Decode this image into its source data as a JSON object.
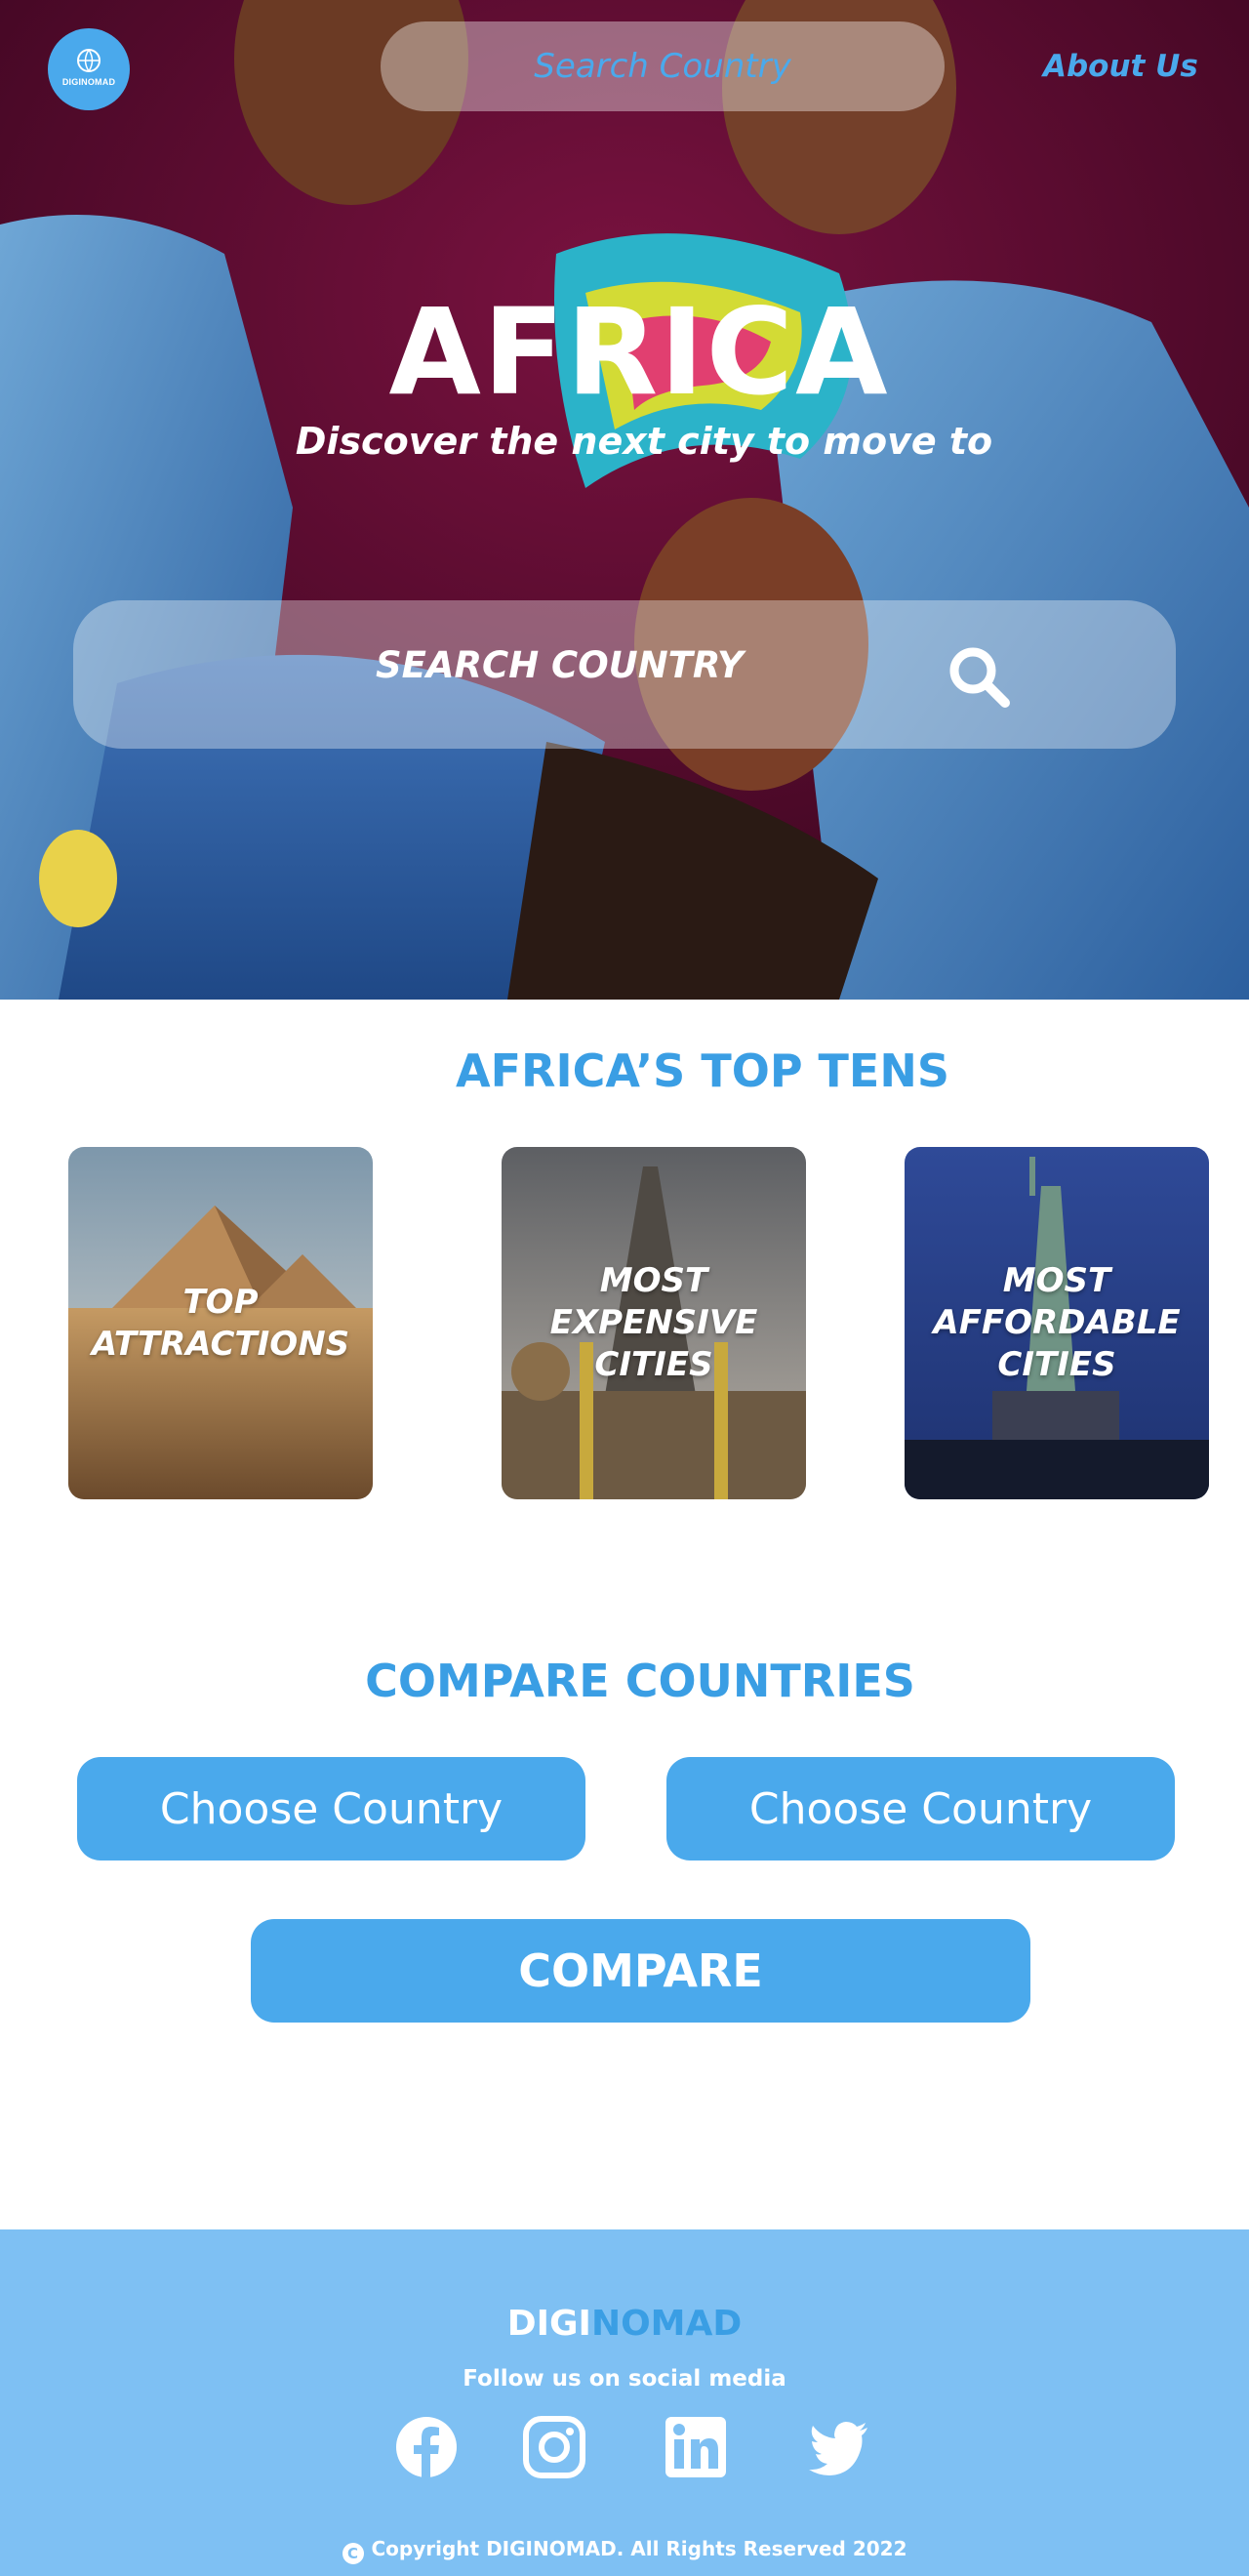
{
  "colors": {
    "accent": "#4aa9ec",
    "heading": "#3a9ee4",
    "footer_bg": "#7ec0f3",
    "hero_bg": "#5a0a2c"
  },
  "header": {
    "logo_text": "DIGINOMAD",
    "search_placeholder": "Search Country",
    "about_link": "About Us"
  },
  "hero": {
    "title": "AFRICA",
    "subtitle": "Discover the next city to move to",
    "search_label": "SEARCH COUNTRY",
    "search_icon": "search-icon"
  },
  "top_tens": {
    "title": "AFRICA’S TOP TENS",
    "cards": [
      {
        "label": "TOP\nATTRACTIONS",
        "image": "pyramids"
      },
      {
        "label": "MOST\nEXPENSIVE\nCITIES",
        "image": "eiffel-tower"
      },
      {
        "label": "MOST\nAFFORDABLE\nCITIES",
        "image": "statue-of-liberty"
      }
    ]
  },
  "compare": {
    "title": "COMPARE COUNTRIES",
    "choose_left": "Choose Country",
    "choose_right": "Choose Country",
    "compare_button": "COMPARE"
  },
  "footer": {
    "brand_a": "DIGI",
    "brand_b": "NOMAD",
    "follow": "Follow us on social media",
    "social_icons": [
      "facebook-icon",
      "instagram-icon",
      "linkedin-icon",
      "twitter-icon"
    ],
    "copyright": "Copyright DIGINOMAD. All Rights Reserved 2022"
  }
}
